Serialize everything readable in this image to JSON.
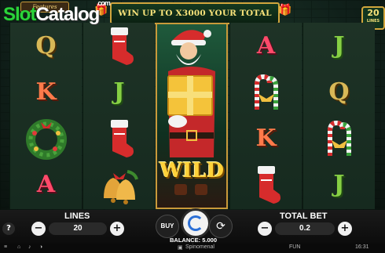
{
  "header": {
    "watermark_main": "Slot",
    "watermark_accent": "Catalog",
    "watermark_suffix": "com",
    "features_tab": "Features",
    "banner_text": "WIN UP TO X3000 YOUR TOTAL BET",
    "lines_badge_number": "20",
    "lines_badge_label": "LINES"
  },
  "reels": {
    "reel1": [
      "Q",
      "K",
      "wreath",
      "A"
    ],
    "reel2": [
      "stocking",
      "J",
      "stocking",
      "bells"
    ],
    "reel3": "wild-santa",
    "reel4": [
      "A",
      "candy-canes",
      "K",
      "stocking"
    ],
    "reel5": [
      "J",
      "Q",
      "candy-canes",
      "J"
    ],
    "wild_label": "WILD"
  },
  "controls": {
    "help": "?",
    "lines_label": "LINES",
    "lines_value": "20",
    "minus": "−",
    "plus": "+",
    "buy_label": "BUY",
    "total_bet_label": "TOTAL BET",
    "total_bet_value": "0.2",
    "balance_text": "BALANCE: 5.000"
  },
  "statusbar": {
    "brand": "Spinomenal",
    "mode": "FUN",
    "time": "16:31"
  },
  "colors": {
    "accent_gold": "#d2a63d",
    "wild_yellow": "#ffd23a",
    "spin_blue": "#2b6fd6"
  }
}
